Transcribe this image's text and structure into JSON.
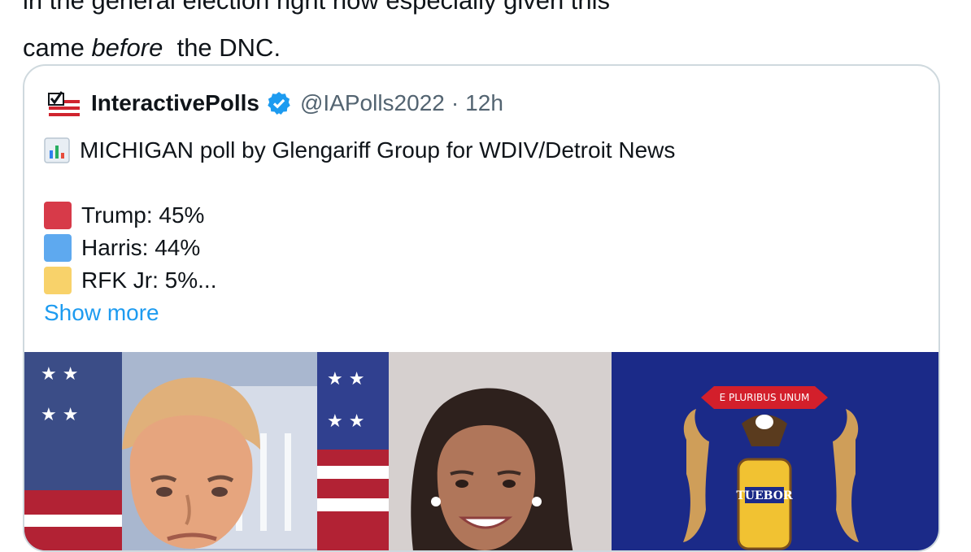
{
  "post": {
    "text_line1": "in the general election right now especially given this",
    "text_line2_start": "came",
    "text_line2_em": "before",
    "text_line2_end": "the DNC."
  },
  "quote": {
    "name": "InteractivePolls",
    "handle": "@IAPolls2022",
    "separator": "·",
    "time": "12h",
    "headline": "MICHIGAN poll by Glengariff Group for WDIV/Detroit News",
    "candidates": [
      {
        "label": "Trump: 45%",
        "color": "#d73a49"
      },
      {
        "label": "Harris: 44%",
        "color": "#5ea9ef"
      },
      {
        "label": "RFK Jr: 5%...",
        "color": "#f8d26a"
      }
    ],
    "show_more": "Show more"
  },
  "media": {
    "flag_banner_text": "E PLURIBUS UNUM",
    "flag_shield_text": "TUEBOR"
  },
  "colors": {
    "link": "#1d9bf0",
    "muted": "#536471",
    "border": "#cfd9de",
    "michigan_blue": "#1b2a88"
  }
}
